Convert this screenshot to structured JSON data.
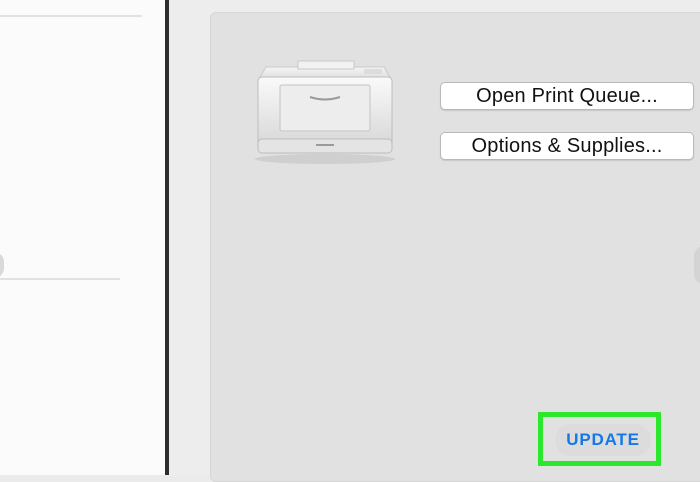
{
  "print_panel": {
    "open_queue_label": "Open Print Queue...",
    "options_supplies_label": "Options & Supplies...",
    "update_label": "UPDATE",
    "printer_icon": "printer-icon"
  },
  "colors": {
    "accent_blue": "#1677e6",
    "highlight_green": "#2ce82a"
  }
}
